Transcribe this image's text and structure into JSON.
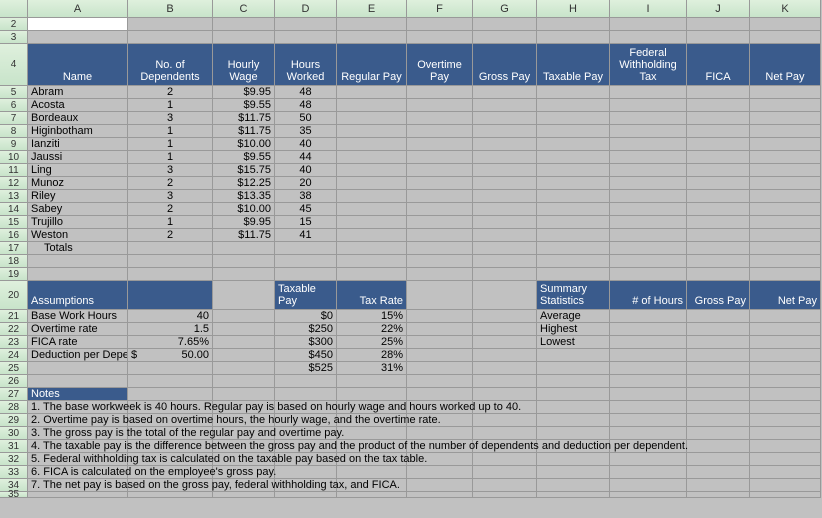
{
  "columns": [
    "A",
    "B",
    "C",
    "D",
    "E",
    "F",
    "G",
    "H",
    "I",
    "J",
    "K"
  ],
  "headers": {
    "A": "Name",
    "B": "No. of Dependents",
    "C": "Hourly Wage",
    "D": "Hours Worked",
    "E": "Regular Pay",
    "F": "Overtime Pay",
    "G": "Gross Pay",
    "H": "Taxable Pay",
    "I": "Federal Withholding Tax",
    "J": "FICA",
    "K": "Net Pay"
  },
  "employees": [
    {
      "name": "Abram",
      "dep": "2",
      "wage": "$9.95",
      "hours": "48"
    },
    {
      "name": "Acosta",
      "dep": "1",
      "wage": "$9.55",
      "hours": "48"
    },
    {
      "name": "Bordeaux",
      "dep": "3",
      "wage": "$11.75",
      "hours": "50"
    },
    {
      "name": "Higinbotham",
      "dep": "1",
      "wage": "$11.75",
      "hours": "35"
    },
    {
      "name": "Ianziti",
      "dep": "1",
      "wage": "$10.00",
      "hours": "40"
    },
    {
      "name": "Jaussi",
      "dep": "1",
      "wage": "$9.55",
      "hours": "44"
    },
    {
      "name": "Ling",
      "dep": "3",
      "wage": "$15.75",
      "hours": "40"
    },
    {
      "name": "Munoz",
      "dep": "2",
      "wage": "$12.25",
      "hours": "20"
    },
    {
      "name": "Riley",
      "dep": "3",
      "wage": "$13.35",
      "hours": "38"
    },
    {
      "name": "Sabey",
      "dep": "2",
      "wage": "$10.00",
      "hours": "45"
    },
    {
      "name": "Trujillo",
      "dep": "1",
      "wage": "$9.95",
      "hours": "15"
    },
    {
      "name": "Weston",
      "dep": "2",
      "wage": "$11.75",
      "hours": "41"
    }
  ],
  "totals_label": "Totals",
  "section_headers": {
    "assumptions": "Assumptions",
    "taxable_pay": "Taxable Pay",
    "tax_rate": "Tax Rate",
    "summary": "Summary Statistics",
    "hours": "# of Hours",
    "grosspay": "Gross Pay",
    "netpay": "Net Pay"
  },
  "assumptions": [
    {
      "label": "Base Work Hours",
      "val": "40"
    },
    {
      "label": "Overtime rate",
      "val": "1.5"
    },
    {
      "label": "FICA rate",
      "val": "7.65%"
    },
    {
      "label": "Deduction per Depend",
      "prefix": "$",
      "val": "50.00"
    }
  ],
  "tax_table": [
    {
      "pay": "$0",
      "rate": "15%"
    },
    {
      "pay": "$250",
      "rate": "22%"
    },
    {
      "pay": "$300",
      "rate": "25%"
    },
    {
      "pay": "$450",
      "rate": "28%"
    },
    {
      "pay": "$525",
      "rate": "31%"
    }
  ],
  "summary_rows": [
    "Average",
    "Highest",
    "Lowest"
  ],
  "notes_header": "Notes",
  "notes": [
    "1. The base workweek is 40 hours. Regular pay is based on hourly wage and hours worked up to 40.",
    "2. Overtime pay is based on overtime hours, the hourly wage, and the overtime rate.",
    "3. The gross pay is the total of the regular pay and overtime pay.",
    "4. The taxable pay is the difference between the gross pay     and the product of the number of dependents and deduction per dependent.",
    "5. Federal withholding tax is calculated on the taxable pay based on the tax table.",
    "6. FICA is calculated on the employee's gross pay.",
    "7. The net pay is based on the gross pay, federal withholding tax, and FICA."
  ],
  "row_numbers_start": 2,
  "row_numbers_end": 35
}
